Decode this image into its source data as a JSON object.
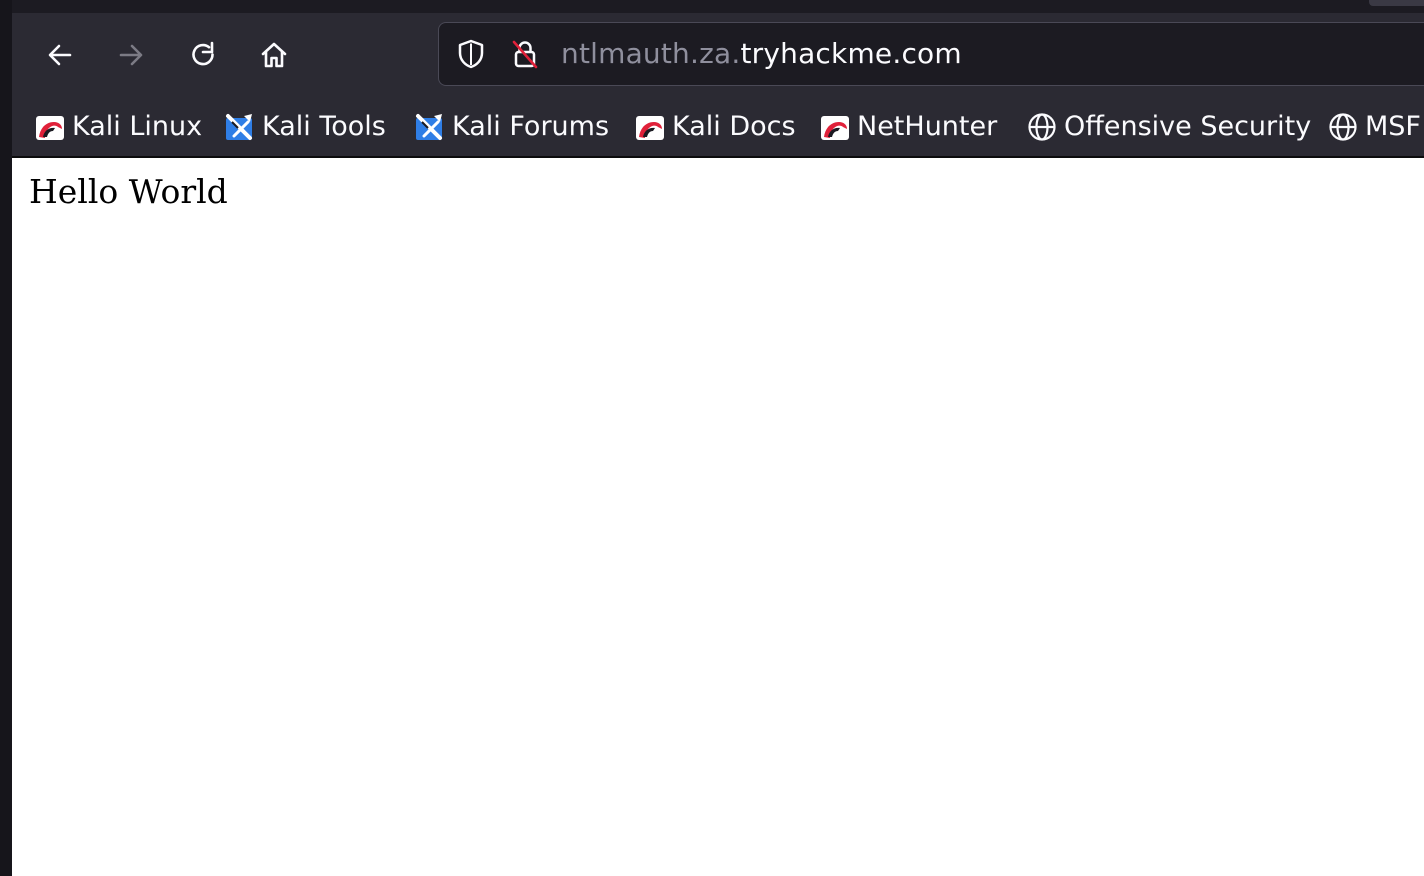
{
  "navbar": {
    "back_icon": "arrow-left-icon",
    "forward_icon": "arrow-right-icon",
    "reload_icon": "reload-icon",
    "home_icon": "home-icon"
  },
  "urlbar": {
    "shield_icon": "shield-icon",
    "lock_icon": "insecure-lock-icon",
    "url_subdomain": "ntlmauth.za.",
    "url_domain": "tryhackme.com"
  },
  "bookmarks": [
    {
      "label": "Kali Linux",
      "icon": "kali-dragon-icon"
    },
    {
      "label": "Kali Tools",
      "icon": "kali-tools-icon"
    },
    {
      "label": "Kali Forums",
      "icon": "kali-forums-icon"
    },
    {
      "label": "Kali Docs",
      "icon": "kali-dragon-icon"
    },
    {
      "label": "NetHunter",
      "icon": "kali-dragon-icon"
    },
    {
      "label": "Offensive Security",
      "icon": "globe-icon"
    },
    {
      "label": "MSF",
      "icon": "globe-icon"
    }
  ],
  "page": {
    "body_text": "Hello World"
  },
  "colors": {
    "toolbar_bg": "#2b2a33",
    "urlbar_bg": "#1c1b22",
    "text_light": "#fbfbfe",
    "text_dim": "#8f8f9d",
    "kali_red": "#e0213a",
    "kali_blue": "#2f7ee6"
  }
}
